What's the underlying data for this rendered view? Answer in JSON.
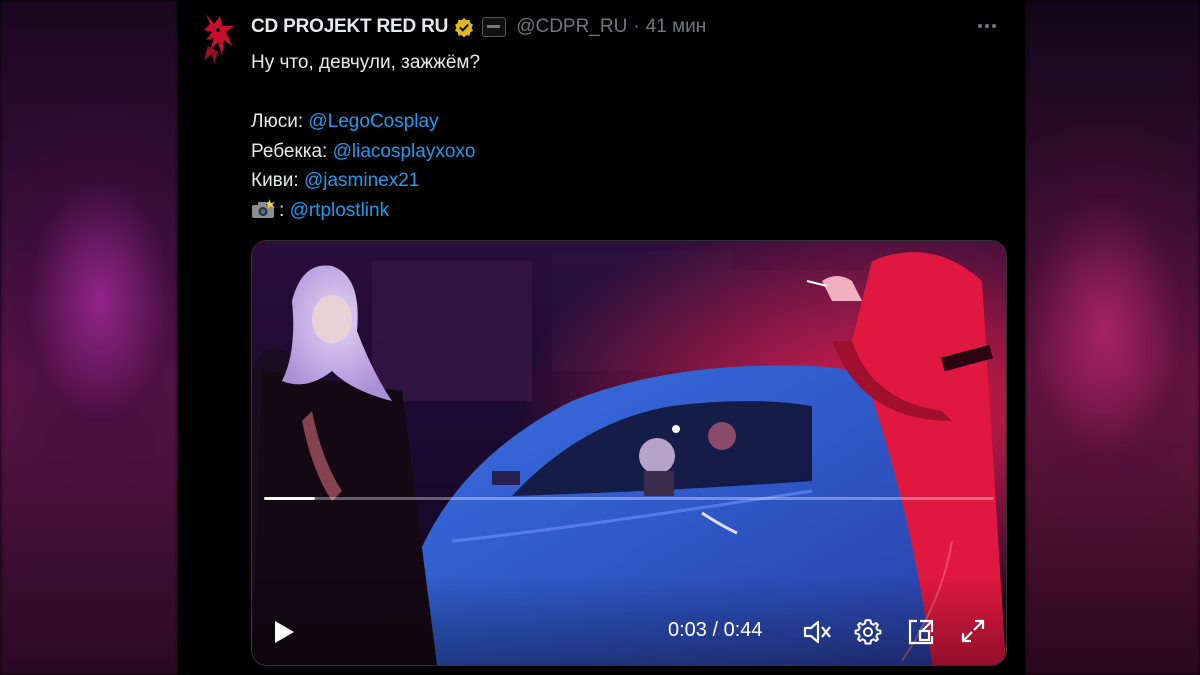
{
  "author": {
    "name": "CD PROJEKT RED RU",
    "handle": "@CDPR_RU",
    "separator": "·",
    "time": "41 мин"
  },
  "tweet": {
    "line1": "Ну что, девчули, зажжём?",
    "credits": [
      {
        "label": "Люси: ",
        "mention": "@LegoCosplay"
      },
      {
        "label": "Ребекка: ",
        "mention": "@liacosplayxoxo"
      },
      {
        "label": "Киви: ",
        "mention": "@jasminex21"
      },
      {
        "label": ": ",
        "mention": "@rtplostlink",
        "icon": "camera-flash-icon"
      }
    ]
  },
  "video": {
    "current_time": "0:03",
    "duration": "0:44",
    "timecode": "0:03 / 0:44",
    "progress": 0.07
  },
  "colors": {
    "link": "#1d9bf0",
    "muted": "#71767b",
    "text": "#e7e9ea",
    "verified": "#e2b719",
    "brand_red": "#c8102e"
  }
}
